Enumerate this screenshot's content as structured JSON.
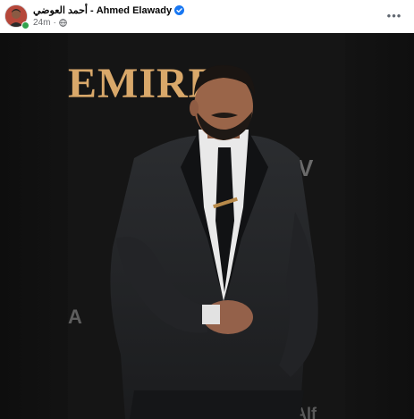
{
  "post": {
    "author_name": "أحمد العوضي - Ahmed Elawady",
    "timestamp": "24m",
    "separator": "·",
    "audience_icon": "globe-icon",
    "verified_icon": "verified-badge-icon",
    "more_icon": "more-options-icon",
    "more_label": "•••"
  },
  "photo": {
    "backdrop_text": "EMIRE",
    "backdrop_text_color": "#d9a86a"
  },
  "colors": {
    "verified": "#1877f2",
    "online": "#31a24c",
    "meta_text": "#65676b"
  }
}
